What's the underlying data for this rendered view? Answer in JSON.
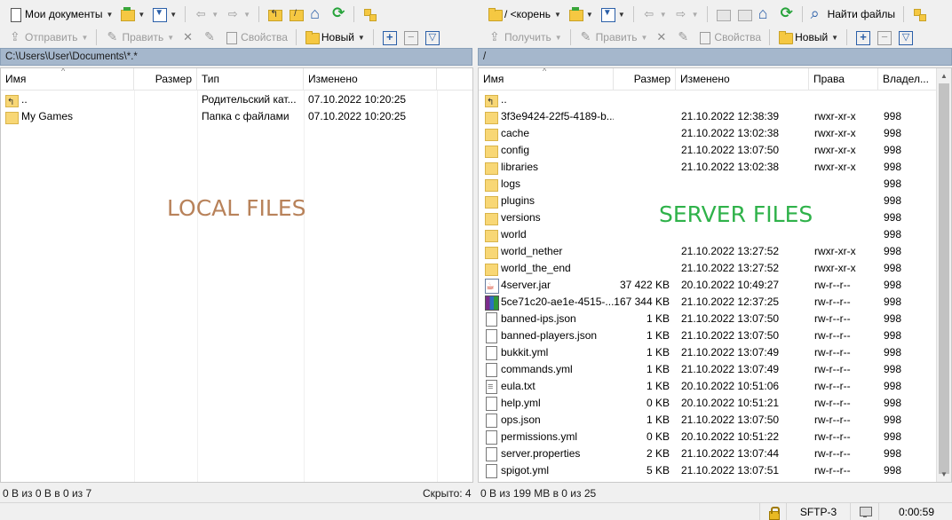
{
  "left_toolbar1": {
    "location": "Мои документы",
    "buttons": [
      "open-folder-icon",
      "filter-icon",
      "back-icon",
      "forward-icon",
      "parent-dir-icon",
      "root-dir-icon",
      "home-icon",
      "refresh-icon",
      "sync-browse-icon"
    ]
  },
  "right_toolbar1": {
    "location": "/ <корень",
    "find_label": "Найти файлы"
  },
  "left_toolbar2": {
    "send_label": "Отправить",
    "edit_label": "Править",
    "props_label": "Свойства",
    "new_label": "Новый"
  },
  "right_toolbar2": {
    "get_label": "Получить",
    "edit_label": "Править",
    "props_label": "Свойства",
    "new_label": "Новый"
  },
  "left_path": "C:\\Users\\User\\Documents\\*.*",
  "right_path": "/",
  "left_panel": {
    "columns": {
      "name": "Имя",
      "size": "Размер",
      "type": "Тип",
      "modified": "Изменено"
    },
    "rows": [
      {
        "name": "..",
        "size": "",
        "type": "Родительский кат...",
        "modified": "07.10.2022  10:20:25",
        "icon": "parent"
      },
      {
        "name": "My Games",
        "size": "",
        "type": "Папка с файлами",
        "modified": "07.10.2022  10:20:25",
        "icon": "folder"
      }
    ],
    "watermark": "LOCAL FILES",
    "watermark_color": "#b8825a"
  },
  "right_panel": {
    "columns": {
      "name": "Имя",
      "size": "Размер",
      "modified": "Изменено",
      "rights": "Права",
      "owner": "Владел..."
    },
    "rows": [
      {
        "name": "..",
        "size": "",
        "modified": "",
        "rights": "",
        "owner": "",
        "icon": "parent"
      },
      {
        "name": "3f3e9424-22f5-4189-b...",
        "size": "",
        "modified": "21.10.2022 12:38:39",
        "rights": "rwxr-xr-x",
        "owner": "998",
        "icon": "folder"
      },
      {
        "name": "cache",
        "size": "",
        "modified": "21.10.2022 13:02:38",
        "rights": "rwxr-xr-x",
        "owner": "998",
        "icon": "folder"
      },
      {
        "name": "config",
        "size": "",
        "modified": "21.10.2022 13:07:50",
        "rights": "rwxr-xr-x",
        "owner": "998",
        "icon": "folder"
      },
      {
        "name": "libraries",
        "size": "",
        "modified": "21.10.2022 13:02:38",
        "rights": "rwxr-xr-x",
        "owner": "998",
        "icon": "folder"
      },
      {
        "name": "logs",
        "size": "",
        "modified": "",
        "rights": "",
        "owner": "998",
        "icon": "folder"
      },
      {
        "name": "plugins",
        "size": "",
        "modified": "",
        "rights": "",
        "owner": "998",
        "icon": "folder"
      },
      {
        "name": "versions",
        "size": "",
        "modified": "",
        "rights": "",
        "owner": "998",
        "icon": "folder"
      },
      {
        "name": "world",
        "size": "",
        "modified": "",
        "rights": "",
        "owner": "998",
        "icon": "folder"
      },
      {
        "name": "world_nether",
        "size": "",
        "modified": "21.10.2022 13:27:52",
        "rights": "rwxr-xr-x",
        "owner": "998",
        "icon": "folder"
      },
      {
        "name": "world_the_end",
        "size": "",
        "modified": "21.10.2022 13:27:52",
        "rights": "rwxr-xr-x",
        "owner": "998",
        "icon": "folder"
      },
      {
        "name": "4server.jar",
        "size": "37 422 KB",
        "modified": "20.10.2022 10:49:27",
        "rights": "rw-r--r--",
        "owner": "998",
        "icon": "jar"
      },
      {
        "name": "5ce71c20-ae1e-4515-...",
        "size": "167 344 KB",
        "modified": "21.10.2022 12:37:25",
        "rights": "rw-r--r--",
        "owner": "998",
        "icon": "archive"
      },
      {
        "name": "banned-ips.json",
        "size": "1 KB",
        "modified": "21.10.2022 13:07:50",
        "rights": "rw-r--r--",
        "owner": "998",
        "icon": "file"
      },
      {
        "name": "banned-players.json",
        "size": "1 KB",
        "modified": "21.10.2022 13:07:50",
        "rights": "rw-r--r--",
        "owner": "998",
        "icon": "file"
      },
      {
        "name": "bukkit.yml",
        "size": "1 KB",
        "modified": "21.10.2022 13:07:49",
        "rights": "rw-r--r--",
        "owner": "998",
        "icon": "file"
      },
      {
        "name": "commands.yml",
        "size": "1 KB",
        "modified": "21.10.2022 13:07:49",
        "rights": "rw-r--r--",
        "owner": "998",
        "icon": "file"
      },
      {
        "name": "eula.txt",
        "size": "1 KB",
        "modified": "20.10.2022 10:51:06",
        "rights": "rw-r--r--",
        "owner": "998",
        "icon": "text"
      },
      {
        "name": "help.yml",
        "size": "0 KB",
        "modified": "20.10.2022 10:51:21",
        "rights": "rw-r--r--",
        "owner": "998",
        "icon": "file"
      },
      {
        "name": "ops.json",
        "size": "1 KB",
        "modified": "21.10.2022 13:07:50",
        "rights": "rw-r--r--",
        "owner": "998",
        "icon": "file"
      },
      {
        "name": "permissions.yml",
        "size": "0 KB",
        "modified": "20.10.2022 10:51:22",
        "rights": "rw-r--r--",
        "owner": "998",
        "icon": "file"
      },
      {
        "name": "server.properties",
        "size": "2 KB",
        "modified": "21.10.2022 13:07:44",
        "rights": "rw-r--r--",
        "owner": "998",
        "icon": "file"
      },
      {
        "name": "spigot.yml",
        "size": "5 KB",
        "modified": "21.10.2022 13:07:51",
        "rights": "rw-r--r--",
        "owner": "998",
        "icon": "file"
      }
    ],
    "watermark": "SERVER FILES",
    "watermark_color": "#2fb24a"
  },
  "left_status": "0 B из 0 B в 0 из 7",
  "left_hidden": "Скрыто: 4",
  "right_status": "0 B из 199 MB в 0 из 25",
  "bottom": {
    "protocol": "SFTP-3",
    "timer": "0:00:59"
  },
  "colors": {
    "pathbar": "#a5b7cc",
    "accent": "#2b5fa8"
  }
}
